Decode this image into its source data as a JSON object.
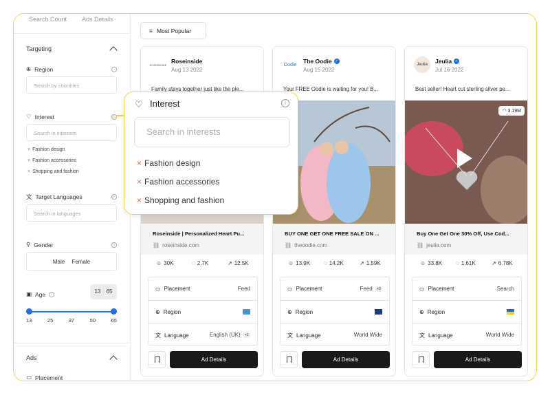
{
  "sidebar": {
    "tabs": [
      "Search Count",
      "Ads Details"
    ],
    "targeting_title": "Targeting",
    "region_label": "Region",
    "region_placeholder": "Search by countries",
    "interest_label": "Interest",
    "interest_placeholder": "Search in interests",
    "interest_tags": [
      "Fashion design",
      "Fashion accessories",
      "Shopping and fashion"
    ],
    "languages_label": "Target Languages",
    "languages_placeholder": "Search in languages",
    "gender_label": "Gender",
    "gender_options": [
      "Male",
      "Female"
    ],
    "age_label": "Age",
    "age_min": "13",
    "age_max": "65",
    "age_ticks": [
      "13",
      "25",
      "37",
      "50",
      "65"
    ],
    "ads_title": "Ads",
    "placement_label": "Placement"
  },
  "toolbar": {
    "sort_label": "Most Popular"
  },
  "popover": {
    "title": "Interest",
    "placeholder": "Search in interests",
    "tags": [
      "Fashion design",
      "Fashion accessories",
      "Shopping and fashion"
    ]
  },
  "cards": [
    {
      "brand": "Roseinside",
      "logo_text": "ROSEINSIDE",
      "date": "Aug 13 2022",
      "description": "Family stays together just like the pie...",
      "title": "Roseinside | Personalized Heart Pu...",
      "url": "roseinside.com",
      "likes": "30K",
      "comments": "2.7K",
      "shares": "12.5K",
      "placement": "Feed",
      "placement_extra": "",
      "region_flag": "badge",
      "language": "English (UK)",
      "language_extra": "+1",
      "action": "Ad Details"
    },
    {
      "brand": "The Oodie",
      "logo_text": "Oodie",
      "date": "Aug 15 2022",
      "description": "Your FREE Oodie is waiting for you! B...",
      "title": "BUY ONE GET ONE FREE SALE ON ...",
      "url": "theoodie.com",
      "likes": "13.9K",
      "comments": "14.2K",
      "shares": "1.59K",
      "placement": "Feed",
      "placement_extra": "+3",
      "region_flag": "au",
      "language": "World Wide",
      "language_extra": "",
      "action": "Ad Details"
    },
    {
      "brand": "Jeulia",
      "logo_text": "Jeulia",
      "date": "Jul 16 2022",
      "description": "Best seller! Heart cut sterling silver pe...",
      "title": "Buy One Get One 30% Off, Use Cod...",
      "url": "jeulia.com",
      "likes": "33.8K",
      "comments": "1.61K",
      "shares": "6.78K",
      "placement": "Search",
      "placement_extra": "",
      "region_flag": "ua",
      "language": "World Wide",
      "language_extra": "",
      "views": "3.19M",
      "action": "Ad Details"
    }
  ],
  "labels": {
    "placement": "Placement",
    "region": "Region",
    "language": "Language"
  },
  "colors": {
    "accent_yellow": "#f2d64a",
    "accent_blue": "#1e6fe6",
    "button_dark": "#1a1a1a"
  }
}
